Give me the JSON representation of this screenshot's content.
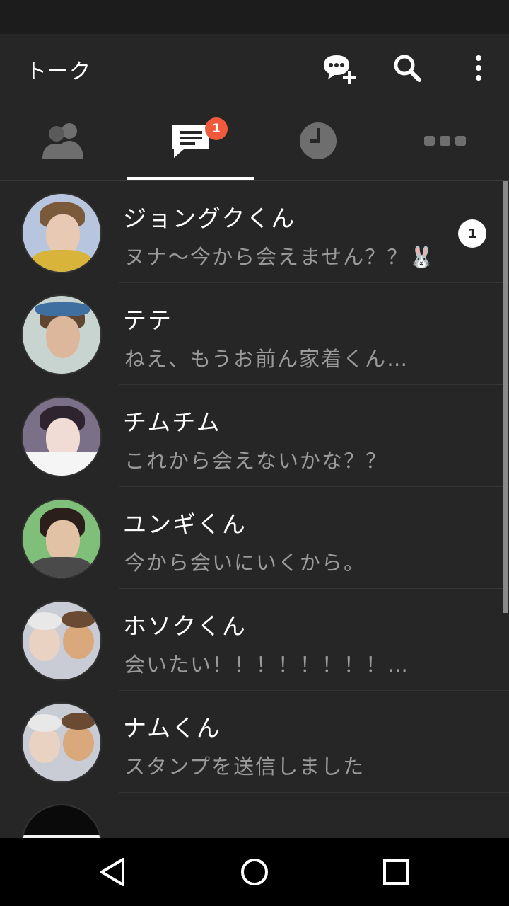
{
  "app_bar": {
    "title": "トーク",
    "actions": [
      {
        "icon": "new-chat-icon"
      },
      {
        "icon": "search-icon"
      },
      {
        "icon": "more-vert-icon"
      }
    ]
  },
  "tabs": [
    {
      "icon": "friends-icon",
      "selected": false
    },
    {
      "icon": "chats-icon",
      "selected": true,
      "badge": "1"
    },
    {
      "icon": "timeline-clock-icon",
      "selected": false
    },
    {
      "icon": "more-dots-icon",
      "selected": false
    }
  ],
  "chats": [
    {
      "name": "ジョングクくん",
      "message": "ヌナ〜今から会えません？？🐰",
      "unread": "1"
    },
    {
      "name": "テテ",
      "message": "ねえ、もうお前ん家着くん…"
    },
    {
      "name": "チムチム",
      "message": "これから会えないかな？？"
    },
    {
      "name": "ユンギくん",
      "message": "今から会いにいくから。"
    },
    {
      "name": "ホソクくん",
      "message": "会いたい！！！！！！！！…"
    },
    {
      "name": "ナムくん",
      "message": "スタンプを送信しました"
    },
    {
      "name": "",
      "message": ""
    }
  ],
  "colors": {
    "background": "#262626",
    "badge": "#ee5a3b",
    "secondary_text": "#9a9a9a"
  },
  "nav": [
    {
      "icon": "back-icon"
    },
    {
      "icon": "home-icon"
    },
    {
      "icon": "recents-icon"
    }
  ]
}
